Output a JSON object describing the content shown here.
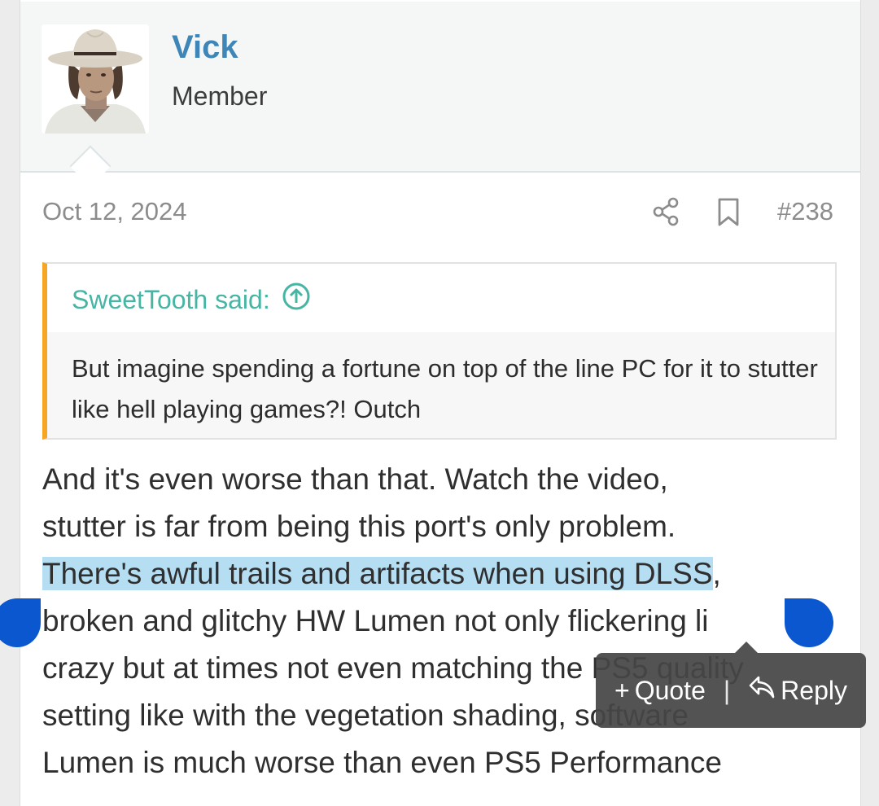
{
  "post": {
    "username": "Vick",
    "user_title": "Member",
    "date": "Oct 12, 2024",
    "post_number": "#238",
    "icons": {
      "share": "share-icon",
      "bookmark": "bookmark-icon",
      "quote_jump": "arrow-up-circle-icon"
    }
  },
  "quote": {
    "attribution": "SweetTooth said:",
    "text": "But imagine spending a fortune on top of the line PC for it to stutter like hell playing games?! Outch"
  },
  "message": {
    "line1": "And it's even worse than that. Watch the video,",
    "line2": "stutter is far from being this port's only problem.",
    "line3_selected": "There's awful trails and artifacts when using DLSS",
    "line3_rest": ",",
    "line4": "broken and glitchy HW Lumen not only flickering li",
    "line5": "crazy but at times not even matching the PS5 quality",
    "line6": "setting like with the vegetation shading, software",
    "line7": "Lumen is much worse than even PS5 Performance"
  },
  "selection_toolbar": {
    "quote_label": "Quote",
    "quote_prefix": "+",
    "separator": "|",
    "reply_label": "Reply"
  },
  "colors": {
    "username": "#3f86b8",
    "quote_accent": "#f6a623",
    "quote_attribution": "#47b5a3",
    "selection_highlight": "#b5def3",
    "selection_handle": "#0b57d0"
  }
}
